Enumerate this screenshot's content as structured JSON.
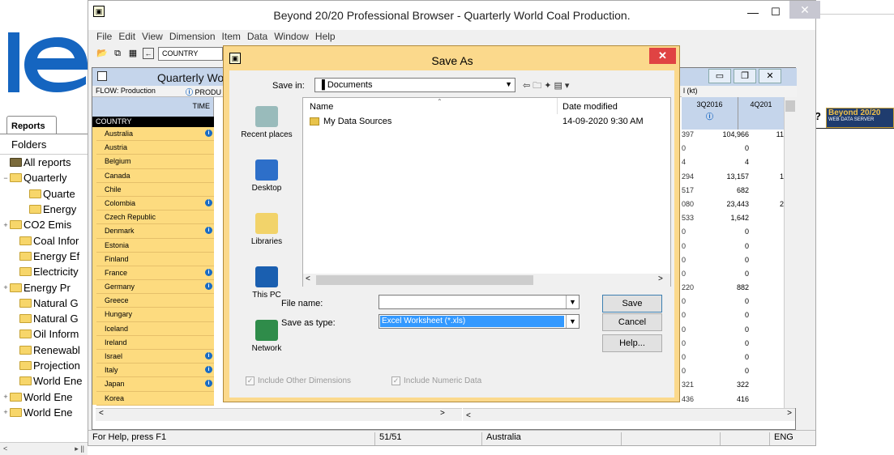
{
  "page": {
    "reports_tab": "Reports",
    "folders_header": "Folders",
    "tree": [
      {
        "pm": "",
        "label": "All reports",
        "indent": 0,
        "icon": "all"
      },
      {
        "pm": "−",
        "label": "Quarterly",
        "indent": 0
      },
      {
        "pm": "",
        "label": "Quarte",
        "indent": 2,
        "open": true
      },
      {
        "pm": "",
        "label": "Energy",
        "indent": 2
      },
      {
        "pm": "+",
        "label": "CO2 Emis",
        "indent": 0
      },
      {
        "pm": "",
        "label": "Coal Infor",
        "indent": 1
      },
      {
        "pm": "",
        "label": "Energy Ef",
        "indent": 1
      },
      {
        "pm": "",
        "label": "Electricity",
        "indent": 1
      },
      {
        "pm": "+",
        "label": "Energy Pr",
        "indent": 0
      },
      {
        "pm": "",
        "label": "Natural G",
        "indent": 1
      },
      {
        "pm": "",
        "label": "Natural G",
        "indent": 1
      },
      {
        "pm": "",
        "label": "Oil Inform",
        "indent": 1
      },
      {
        "pm": "",
        "label": "Renewabl",
        "indent": 1
      },
      {
        "pm": "",
        "label": "Projection",
        "indent": 1
      },
      {
        "pm": "",
        "label": "World Ene",
        "indent": 1
      },
      {
        "pm": "+",
        "label": "World Ene",
        "indent": 0
      },
      {
        "pm": "+",
        "label": "World Ene",
        "indent": 0
      }
    ],
    "badge_text": "Beyond 20/20",
    "badge_sub": "WEB DATA SERVER"
  },
  "app": {
    "title": "Beyond 20/20 Professional Browser - Quarterly World Coal Production.",
    "menu": [
      "File",
      "Edit",
      "View",
      "Dimension",
      "Item",
      "Data",
      "Window",
      "Help"
    ],
    "dimension_select": "COUNTRY",
    "doc_title": "Quarterly Wo",
    "flow_label": "FLOW: Production",
    "product_label": "PRODU",
    "time_label": "TIME",
    "country_header": "COUNTRY",
    "countries": [
      {
        "name": "Australia",
        "info": true
      },
      {
        "name": "Austria",
        "info": false
      },
      {
        "name": "Belgium",
        "info": false
      },
      {
        "name": "Canada",
        "info": false
      },
      {
        "name": "Chile",
        "info": false
      },
      {
        "name": "Colombia",
        "info": true
      },
      {
        "name": "Czech Republic",
        "info": false
      },
      {
        "name": "Denmark",
        "info": true
      },
      {
        "name": "Estonia",
        "info": false
      },
      {
        "name": "Finland",
        "info": false
      },
      {
        "name": "France",
        "info": true
      },
      {
        "name": "Germany",
        "info": true
      },
      {
        "name": "Greece",
        "info": false
      },
      {
        "name": "Hungary",
        "info": false
      },
      {
        "name": "Iceland",
        "info": false
      },
      {
        "name": "Ireland",
        "info": false
      },
      {
        "name": "Israel",
        "info": true
      },
      {
        "name": "Italy",
        "info": true
      },
      {
        "name": "Japan",
        "info": true
      },
      {
        "name": "Korea",
        "info": false
      }
    ],
    "unit_label": "l (kt)",
    "col_headers": [
      "3Q2016",
      "4Q201"
    ],
    "data_rows": [
      [
        "397",
        "104,966",
        "11"
      ],
      [
        "0",
        "0",
        ""
      ],
      [
        "4",
        "4",
        ""
      ],
      [
        "294",
        "13,157",
        "1"
      ],
      [
        "517",
        "682",
        ""
      ],
      [
        "080",
        "23,443",
        "2"
      ],
      [
        "533",
        "1,642",
        ""
      ],
      [
        "0",
        "0",
        ""
      ],
      [
        "0",
        "0",
        ""
      ],
      [
        "0",
        "0",
        ""
      ],
      [
        "0",
        "0",
        ""
      ],
      [
        "220",
        "882",
        ""
      ],
      [
        "0",
        "0",
        ""
      ],
      [
        "0",
        "0",
        ""
      ],
      [
        "0",
        "0",
        ""
      ],
      [
        "0",
        "0",
        ""
      ],
      [
        "0",
        "0",
        ""
      ],
      [
        "0",
        "0",
        ""
      ],
      [
        "321",
        "322",
        ""
      ],
      [
        "436",
        "416",
        ""
      ]
    ],
    "status": {
      "help": "For Help, press F1",
      "position": "51/51",
      "current": "Australia",
      "lang": "ENG"
    }
  },
  "dialog": {
    "title": "Save As",
    "save_in_label": "Save in:",
    "save_in_value": "Documents",
    "places": [
      "Recent places",
      "Desktop",
      "Libraries",
      "This PC",
      "Network"
    ],
    "columns": {
      "name": "Name",
      "date": "Date modified"
    },
    "files": [
      {
        "name": "My Data Sources",
        "date": "14-09-2020 9:30 AM"
      }
    ],
    "file_name_label": "File name:",
    "file_name_value": "",
    "save_type_label": "Save as type:",
    "save_type_value": "Excel Worksheet (*.xls)",
    "buttons": {
      "save": "Save",
      "cancel": "Cancel",
      "help": "Help..."
    },
    "checks": [
      "Include Other Dimensions",
      "Include Numeric Data"
    ]
  }
}
